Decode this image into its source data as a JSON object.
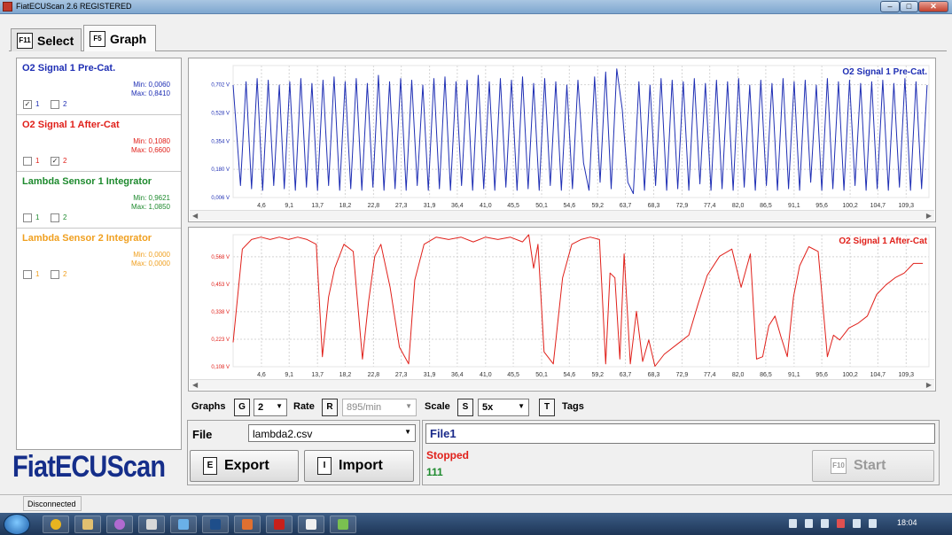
{
  "window": {
    "title": "FiatECUScan 2.6 REGISTERED",
    "minimize": "–",
    "maximize": "□",
    "close": "✕"
  },
  "tabs": [
    {
      "key": "F11",
      "label": "Select"
    },
    {
      "key": "F5",
      "label": "Graph"
    }
  ],
  "signals": [
    {
      "title": "O2 Signal 1 Pre-Cat.",
      "color": "#1f2fb4",
      "min": "Min: 0,0060",
      "max": "Max: 0,8410",
      "cb1": true,
      "cb2": false
    },
    {
      "title": "O2 Signal 1 After-Cat",
      "color": "#e0201a",
      "min": "Min: 0,1080",
      "max": "Max: 0,6600",
      "cb1": false,
      "cb2": true
    },
    {
      "title": "Lambda Sensor 1 Integrator",
      "color": "#1e8a2e",
      "min": "Min: 0,9621",
      "max": "Max: 1,0850",
      "cb1": false,
      "cb2": false
    },
    {
      "title": "Lambda Sensor 2 Integrator",
      "color": "#f0a020",
      "min": "Min: 0,0000",
      "max": "Max: 0,0000",
      "cb1": false,
      "cb2": false
    }
  ],
  "checkbox_labels": [
    "1",
    "2"
  ],
  "chart_data": [
    {
      "type": "line",
      "legend": "O2 Signal 1 Pre-Cat.",
      "legend_position": "top-right",
      "color": "#1f2fb4",
      "x_ticks": [
        "4,6",
        "9,1",
        "13,7",
        "18,2",
        "22,8",
        "27,3",
        "31,9",
        "36,4",
        "41,0",
        "45,5",
        "50,1",
        "54,6",
        "59,2",
        "63,7",
        "68,3",
        "72,9",
        "77,4",
        "82,0",
        "86,5",
        "91,1",
        "95,6",
        "100,2",
        "104,7",
        "109,3"
      ],
      "y_ticks": [
        "0,006 V",
        "0,180 V",
        "0,354 V",
        "0,528 V",
        "0,702 V"
      ],
      "y_tick_values": [
        0.006,
        0.18,
        0.354,
        0.528,
        0.702
      ],
      "xlim": [
        0,
        113
      ],
      "ylim": [
        0.006,
        0.82
      ],
      "grid": true,
      "x": [
        0.0,
        1.2,
        2.1,
        3.0,
        3.9,
        4.8,
        5.7,
        6.6,
        7.5,
        8.3,
        9.2,
        10.1,
        11.0,
        11.9,
        12.8,
        13.7,
        14.6,
        15.5,
        16.4,
        17.3,
        18.2,
        19.1,
        20.0,
        20.9,
        21.8,
        22.7,
        23.6,
        24.5,
        25.4,
        26.3,
        27.2,
        28.1,
        29.0,
        29.9,
        30.8,
        31.7,
        32.6,
        33.5,
        34.4,
        35.3,
        36.2,
        37.1,
        38.0,
        38.9,
        39.8,
        40.7,
        41.6,
        42.5,
        43.4,
        44.3,
        45.2,
        46.1,
        47.0,
        47.9,
        48.8,
        49.7,
        50.6,
        51.5,
        52.4,
        53.3,
        54.2,
        55.1,
        56.0,
        56.9,
        57.8,
        58.7,
        59.6,
        60.5,
        61.4,
        62.3,
        63.2,
        64.1,
        65.0,
        65.9,
        66.8,
        67.7,
        68.6,
        69.5,
        70.4,
        71.3,
        72.2,
        73.1,
        74.0,
        74.9,
        75.8,
        76.7,
        77.6,
        78.5,
        79.4,
        80.3,
        81.2,
        82.1,
        83.0,
        83.9,
        84.8,
        85.7,
        86.6,
        87.5,
        88.4,
        89.3,
        90.2,
        91.1,
        92.0,
        92.9,
        93.8,
        94.7,
        95.6,
        96.5,
        97.4,
        98.3,
        99.2,
        100.1,
        101.0,
        101.9,
        102.8,
        103.7,
        104.6,
        105.5,
        106.4,
        107.3,
        108.2,
        109.1,
        110.0,
        110.9,
        111.8,
        112.7
      ],
      "values": [
        0.7,
        0.08,
        0.72,
        0.06,
        0.74,
        0.05,
        0.73,
        0.08,
        0.7,
        0.06,
        0.72,
        0.05,
        0.74,
        0.07,
        0.71,
        0.05,
        0.73,
        0.08,
        0.75,
        0.05,
        0.72,
        0.06,
        0.74,
        0.05,
        0.71,
        0.07,
        0.76,
        0.05,
        0.72,
        0.06,
        0.74,
        0.05,
        0.73,
        0.08,
        0.7,
        0.05,
        0.74,
        0.06,
        0.75,
        0.05,
        0.72,
        0.08,
        0.73,
        0.05,
        0.76,
        0.06,
        0.72,
        0.05,
        0.74,
        0.07,
        0.73,
        0.05,
        0.75,
        0.06,
        0.71,
        0.05,
        0.74,
        0.08,
        0.72,
        0.05,
        0.7,
        0.06,
        0.73,
        0.22,
        0.05,
        0.75,
        0.1,
        0.78,
        0.06,
        0.8,
        0.55,
        0.1,
        0.03,
        0.72,
        0.05,
        0.7,
        0.08,
        0.74,
        0.05,
        0.73,
        0.06,
        0.72,
        0.05,
        0.74,
        0.09,
        0.71,
        0.05,
        0.73,
        0.06,
        0.72,
        0.05,
        0.74,
        0.07,
        0.7,
        0.05,
        0.73,
        0.08,
        0.71,
        0.05,
        0.74,
        0.06,
        0.72,
        0.05,
        0.73,
        0.1,
        0.7,
        0.05,
        0.74,
        0.06,
        0.72,
        0.05,
        0.73,
        0.08,
        0.71,
        0.05,
        0.72,
        0.06,
        0.73,
        0.05,
        0.71,
        0.07,
        0.74,
        0.05,
        0.72,
        0.06,
        0.7,
        0.05,
        0.72
      ]
    },
    {
      "type": "line",
      "legend": "O2 Signal 1 After-Cat",
      "legend_position": "top-right",
      "color": "#e0201a",
      "x_ticks": [
        "4,6",
        "9,1",
        "13,7",
        "18,2",
        "22,8",
        "27,3",
        "31,9",
        "36,4",
        "41,0",
        "45,5",
        "50,1",
        "54,6",
        "59,2",
        "63,7",
        "68,3",
        "72,9",
        "77,4",
        "82,0",
        "86,5",
        "91,1",
        "95,6",
        "100,2",
        "104,7",
        "109,3"
      ],
      "y_ticks": [
        "0,108 V",
        "0,223 V",
        "0,338 V",
        "0,453 V",
        "0,568 V"
      ],
      "y_tick_values": [
        0.108,
        0.223,
        0.338,
        0.453,
        0.568
      ],
      "xlim": [
        0,
        113
      ],
      "ylim": [
        0.108,
        0.66
      ],
      "grid": true,
      "x": [
        0.0,
        1.5,
        3.0,
        4.5,
        6.0,
        7.5,
        9.0,
        10.5,
        12.0,
        13.5,
        14.5,
        15.5,
        16.5,
        18.0,
        19.5,
        21.0,
        22.0,
        23.0,
        24.0,
        25.5,
        27.0,
        28.5,
        29.5,
        31.0,
        33.0,
        35.0,
        37.0,
        39.0,
        41.0,
        43.0,
        45.0,
        47.0,
        48.0,
        48.8,
        49.5,
        50.5,
        52.0,
        53.5,
        55.0,
        56.5,
        58.0,
        59.5,
        60.5,
        61.2,
        62.0,
        62.8,
        63.5,
        64.5,
        65.5,
        66.5,
        67.5,
        68.5,
        70.0,
        72.0,
        74.0,
        75.5,
        77.0,
        79.0,
        81.0,
        82.5,
        84.0,
        85.0,
        86.0,
        87.0,
        88.0,
        89.0,
        90.0,
        91.0,
        92.0,
        93.5,
        95.0,
        96.5,
        97.5,
        98.5,
        100.0,
        101.5,
        103.0,
        104.5,
        106.0,
        107.5,
        109.0,
        110.5,
        112.0
      ],
      "values": [
        0.21,
        0.6,
        0.64,
        0.65,
        0.64,
        0.65,
        0.64,
        0.65,
        0.64,
        0.62,
        0.15,
        0.4,
        0.52,
        0.62,
        0.59,
        0.14,
        0.38,
        0.57,
        0.62,
        0.44,
        0.19,
        0.12,
        0.47,
        0.62,
        0.65,
        0.64,
        0.65,
        0.63,
        0.65,
        0.64,
        0.65,
        0.63,
        0.66,
        0.52,
        0.62,
        0.17,
        0.12,
        0.48,
        0.62,
        0.64,
        0.65,
        0.64,
        0.12,
        0.5,
        0.48,
        0.14,
        0.58,
        0.12,
        0.34,
        0.13,
        0.22,
        0.11,
        0.16,
        0.2,
        0.24,
        0.37,
        0.49,
        0.57,
        0.6,
        0.44,
        0.58,
        0.14,
        0.15,
        0.28,
        0.32,
        0.23,
        0.15,
        0.4,
        0.53,
        0.61,
        0.59,
        0.15,
        0.24,
        0.22,
        0.27,
        0.29,
        0.32,
        0.41,
        0.45,
        0.48,
        0.5,
        0.54,
        0.54
      ]
    }
  ],
  "controls": {
    "graphs_label": "Graphs",
    "graphs_key": "G",
    "graphs_value": "2",
    "rate_label": "Rate",
    "rate_key": "R",
    "rate_value": "895/min",
    "scale_label": "Scale",
    "scale_key": "S",
    "scale_value": "5x",
    "tags_key": "T",
    "tags_label": "Tags",
    "dropdown_arrow": "▼"
  },
  "file": {
    "label": "File",
    "value": "lambda2.csv"
  },
  "actions": {
    "export_key": "E",
    "export_label": "Export",
    "import_key": "I",
    "import_label": "Import",
    "start_key": "F10",
    "start_label": "Start"
  },
  "session": {
    "filename": "File1",
    "state": "Stopped",
    "count": "111"
  },
  "logo": "FiatECUScan",
  "statusbar": {
    "connection": "Disconnected"
  },
  "taskbar": {
    "clock": "18:04"
  },
  "colors": {
    "blue": "#1f2fb4",
    "red": "#e0201a",
    "green": "#1e8a2e",
    "orange": "#f0a020",
    "logo": "#152e8a"
  }
}
